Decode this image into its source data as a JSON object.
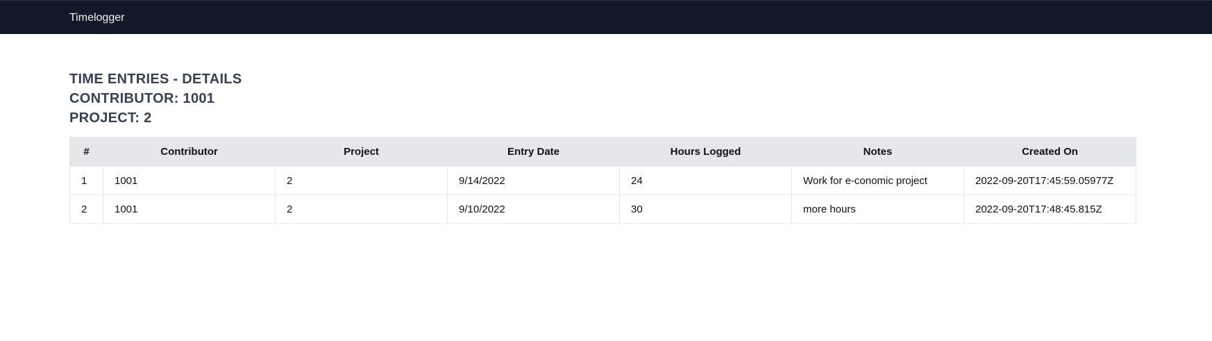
{
  "app": {
    "brand": "Timelogger"
  },
  "page": {
    "heading_title": "TIME ENTRIES - DETAILS",
    "heading_contributor": "CONTRIBUTOR: 1001",
    "heading_project": "PROJECT: 2"
  },
  "table": {
    "headers": [
      "#",
      "Contributor",
      "Project",
      "Entry Date",
      "Hours Logged",
      "Notes",
      "Created On"
    ],
    "rows": [
      [
        "1",
        "1001",
        "2",
        "9/14/2022",
        "24",
        "Work for e-conomic project",
        "2022-09-20T17:45:59.05977Z"
      ],
      [
        "2",
        "1001",
        "2",
        "9/10/2022",
        "30",
        "more hours",
        "2022-09-20T17:48:45.815Z"
      ]
    ]
  }
}
